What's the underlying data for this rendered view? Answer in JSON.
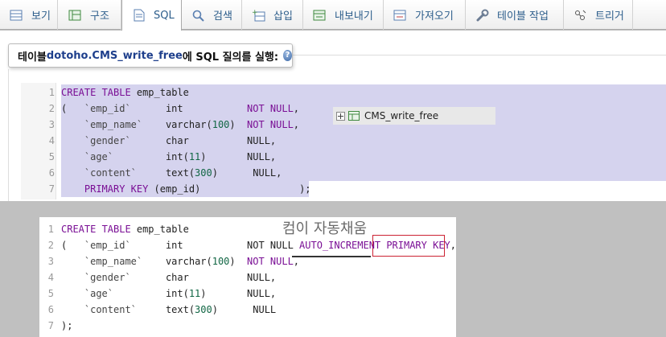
{
  "tabs": [
    {
      "label": "보기",
      "icon": "browse-icon",
      "active": false
    },
    {
      "label": "구조",
      "icon": "structure-icon",
      "active": false
    },
    {
      "label": "SQL",
      "icon": "sql-icon",
      "active": true
    },
    {
      "label": "검색",
      "icon": "search-icon",
      "active": false
    },
    {
      "label": "삽입",
      "icon": "insert-icon",
      "active": false
    },
    {
      "label": "내보내기",
      "icon": "export-icon",
      "active": false
    },
    {
      "label": "가져오기",
      "icon": "import-icon",
      "active": false
    },
    {
      "label": "테이블 작업",
      "icon": "wrench-icon",
      "active": false
    },
    {
      "label": "트리거",
      "icon": "trigger-icon",
      "active": false
    }
  ],
  "caption": {
    "prefix": "테이블 ",
    "table": "dotoho.CMS_write_free",
    "suffix": "에 SQL 질의를 실행:",
    "help_icon": "help-icon"
  },
  "tooltip": {
    "label": "CMS_write_free"
  },
  "editor_top": {
    "lines": [
      {
        "n": "1",
        "tokens": [
          [
            "CREATE TABLE",
            "kw"
          ],
          [
            " emp_table",
            "id"
          ]
        ]
      },
      {
        "n": "2",
        "tokens": [
          [
            "(   ",
            "id"
          ],
          [
            "`emp_id`",
            "bq"
          ],
          [
            "      ",
            "id"
          ],
          [
            "int",
            "typ"
          ],
          [
            "           ",
            "id"
          ],
          [
            "NOT NULL",
            "kw"
          ],
          [
            ",",
            "id"
          ]
        ]
      },
      {
        "n": "3",
        "tokens": [
          [
            "    ",
            "id"
          ],
          [
            "`emp_name`",
            "bq"
          ],
          [
            "    ",
            "id"
          ],
          [
            "varchar(",
            "typ"
          ],
          [
            "100",
            "num"
          ],
          [
            ")",
            "typ"
          ],
          [
            "  ",
            "id"
          ],
          [
            "NOT NULL",
            "kw"
          ],
          [
            ",",
            "id"
          ]
        ]
      },
      {
        "n": "4",
        "tokens": [
          [
            "    ",
            "id"
          ],
          [
            "`gender`",
            "bq"
          ],
          [
            "      ",
            "id"
          ],
          [
            "char",
            "typ"
          ],
          [
            "          ",
            "id"
          ],
          [
            "NULL",
            "id"
          ],
          [
            ",",
            "id"
          ]
        ]
      },
      {
        "n": "5",
        "tokens": [
          [
            "    ",
            "id"
          ],
          [
            "`age`",
            "bq"
          ],
          [
            "         ",
            "id"
          ],
          [
            "int(",
            "typ"
          ],
          [
            "11",
            "num"
          ],
          [
            ")",
            "typ"
          ],
          [
            "       ",
            "id"
          ],
          [
            "NULL",
            "id"
          ],
          [
            ",",
            "id"
          ]
        ]
      },
      {
        "n": "6",
        "tokens": [
          [
            "    ",
            "id"
          ],
          [
            "`content`",
            "bq"
          ],
          [
            "     ",
            "id"
          ],
          [
            "text(",
            "typ"
          ],
          [
            "300",
            "num"
          ],
          [
            ")",
            "typ"
          ],
          [
            "      ",
            "id"
          ],
          [
            "NULL",
            "id"
          ],
          [
            ",",
            "id"
          ]
        ]
      },
      {
        "n": "7",
        "tokens": [
          [
            "    ",
            "id"
          ],
          [
            "PRIMARY KEY",
            "kw"
          ],
          [
            " (emp_id)",
            "id"
          ],
          [
            "                 );",
            "id"
          ]
        ]
      }
    ]
  },
  "editor_bottom": {
    "note": "컴이 자동채움",
    "lines": [
      {
        "n": "1",
        "tokens": [
          [
            "CREATE TABLE",
            "kw"
          ],
          [
            " emp_table",
            "id"
          ]
        ]
      },
      {
        "n": "2",
        "tokens": [
          [
            "(   ",
            "id"
          ],
          [
            "`emp_id`",
            "bq"
          ],
          [
            "      ",
            "id"
          ],
          [
            "int",
            "typ"
          ],
          [
            "           ",
            "id"
          ],
          [
            "NOT NULL",
            "id"
          ],
          [
            " ",
            "id"
          ],
          [
            "AUTO_INCREMENT",
            "kw"
          ],
          [
            " ",
            "id"
          ],
          [
            "PRIMARY KEY",
            "kw"
          ],
          [
            ",",
            "id"
          ]
        ]
      },
      {
        "n": "3",
        "tokens": [
          [
            "    ",
            "id"
          ],
          [
            "`emp_name`",
            "bq"
          ],
          [
            "    ",
            "id"
          ],
          [
            "varchar(",
            "typ"
          ],
          [
            "100",
            "num"
          ],
          [
            ")",
            "typ"
          ],
          [
            "  ",
            "id"
          ],
          [
            "NOT NULL",
            "kw"
          ],
          [
            ",",
            "id"
          ]
        ]
      },
      {
        "n": "4",
        "tokens": [
          [
            "    ",
            "id"
          ],
          [
            "`gender`",
            "bq"
          ],
          [
            "      ",
            "id"
          ],
          [
            "char",
            "typ"
          ],
          [
            "          ",
            "id"
          ],
          [
            "NULL",
            "id"
          ],
          [
            ",",
            "id"
          ]
        ]
      },
      {
        "n": "5",
        "tokens": [
          [
            "    ",
            "id"
          ],
          [
            "`age`",
            "bq"
          ],
          [
            "         ",
            "id"
          ],
          [
            "int(",
            "typ"
          ],
          [
            "11",
            "num"
          ],
          [
            ")",
            "typ"
          ],
          [
            "       ",
            "id"
          ],
          [
            "NULL",
            "id"
          ],
          [
            ",",
            "id"
          ]
        ]
      },
      {
        "n": "6",
        "tokens": [
          [
            "    ",
            "id"
          ],
          [
            "`content`",
            "bq"
          ],
          [
            "     ",
            "id"
          ],
          [
            "text(",
            "typ"
          ],
          [
            "300",
            "num"
          ],
          [
            ")",
            "typ"
          ],
          [
            "      ",
            "id"
          ],
          [
            "NULL",
            "id"
          ]
        ]
      },
      {
        "n": "7",
        "tokens": [
          [
            ");",
            "id"
          ]
        ]
      }
    ]
  },
  "colors": {
    "selection": "#d5d3ee",
    "keyword": "#7a0f95",
    "highlight_box": "#cc2233"
  }
}
